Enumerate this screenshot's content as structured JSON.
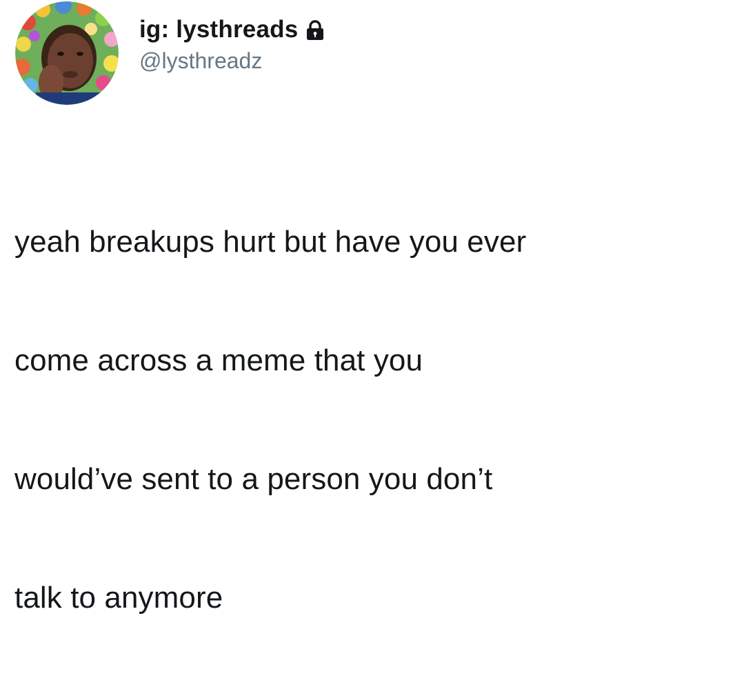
{
  "tweet": {
    "author": {
      "display_name": "ig: lysthreads",
      "handle": "@lysthreadz",
      "lock_icon": "lock-icon",
      "avatar_icon": "avatar-photo"
    },
    "text_lines": [
      "yeah breakups hurt but have you ever",
      "come across a meme that you",
      "would’ve sent to a person you don’t",
      "talk to anymore"
    ]
  },
  "colors": {
    "text": "#14171a",
    "handle": "#657786",
    "background": "#ffffff"
  }
}
